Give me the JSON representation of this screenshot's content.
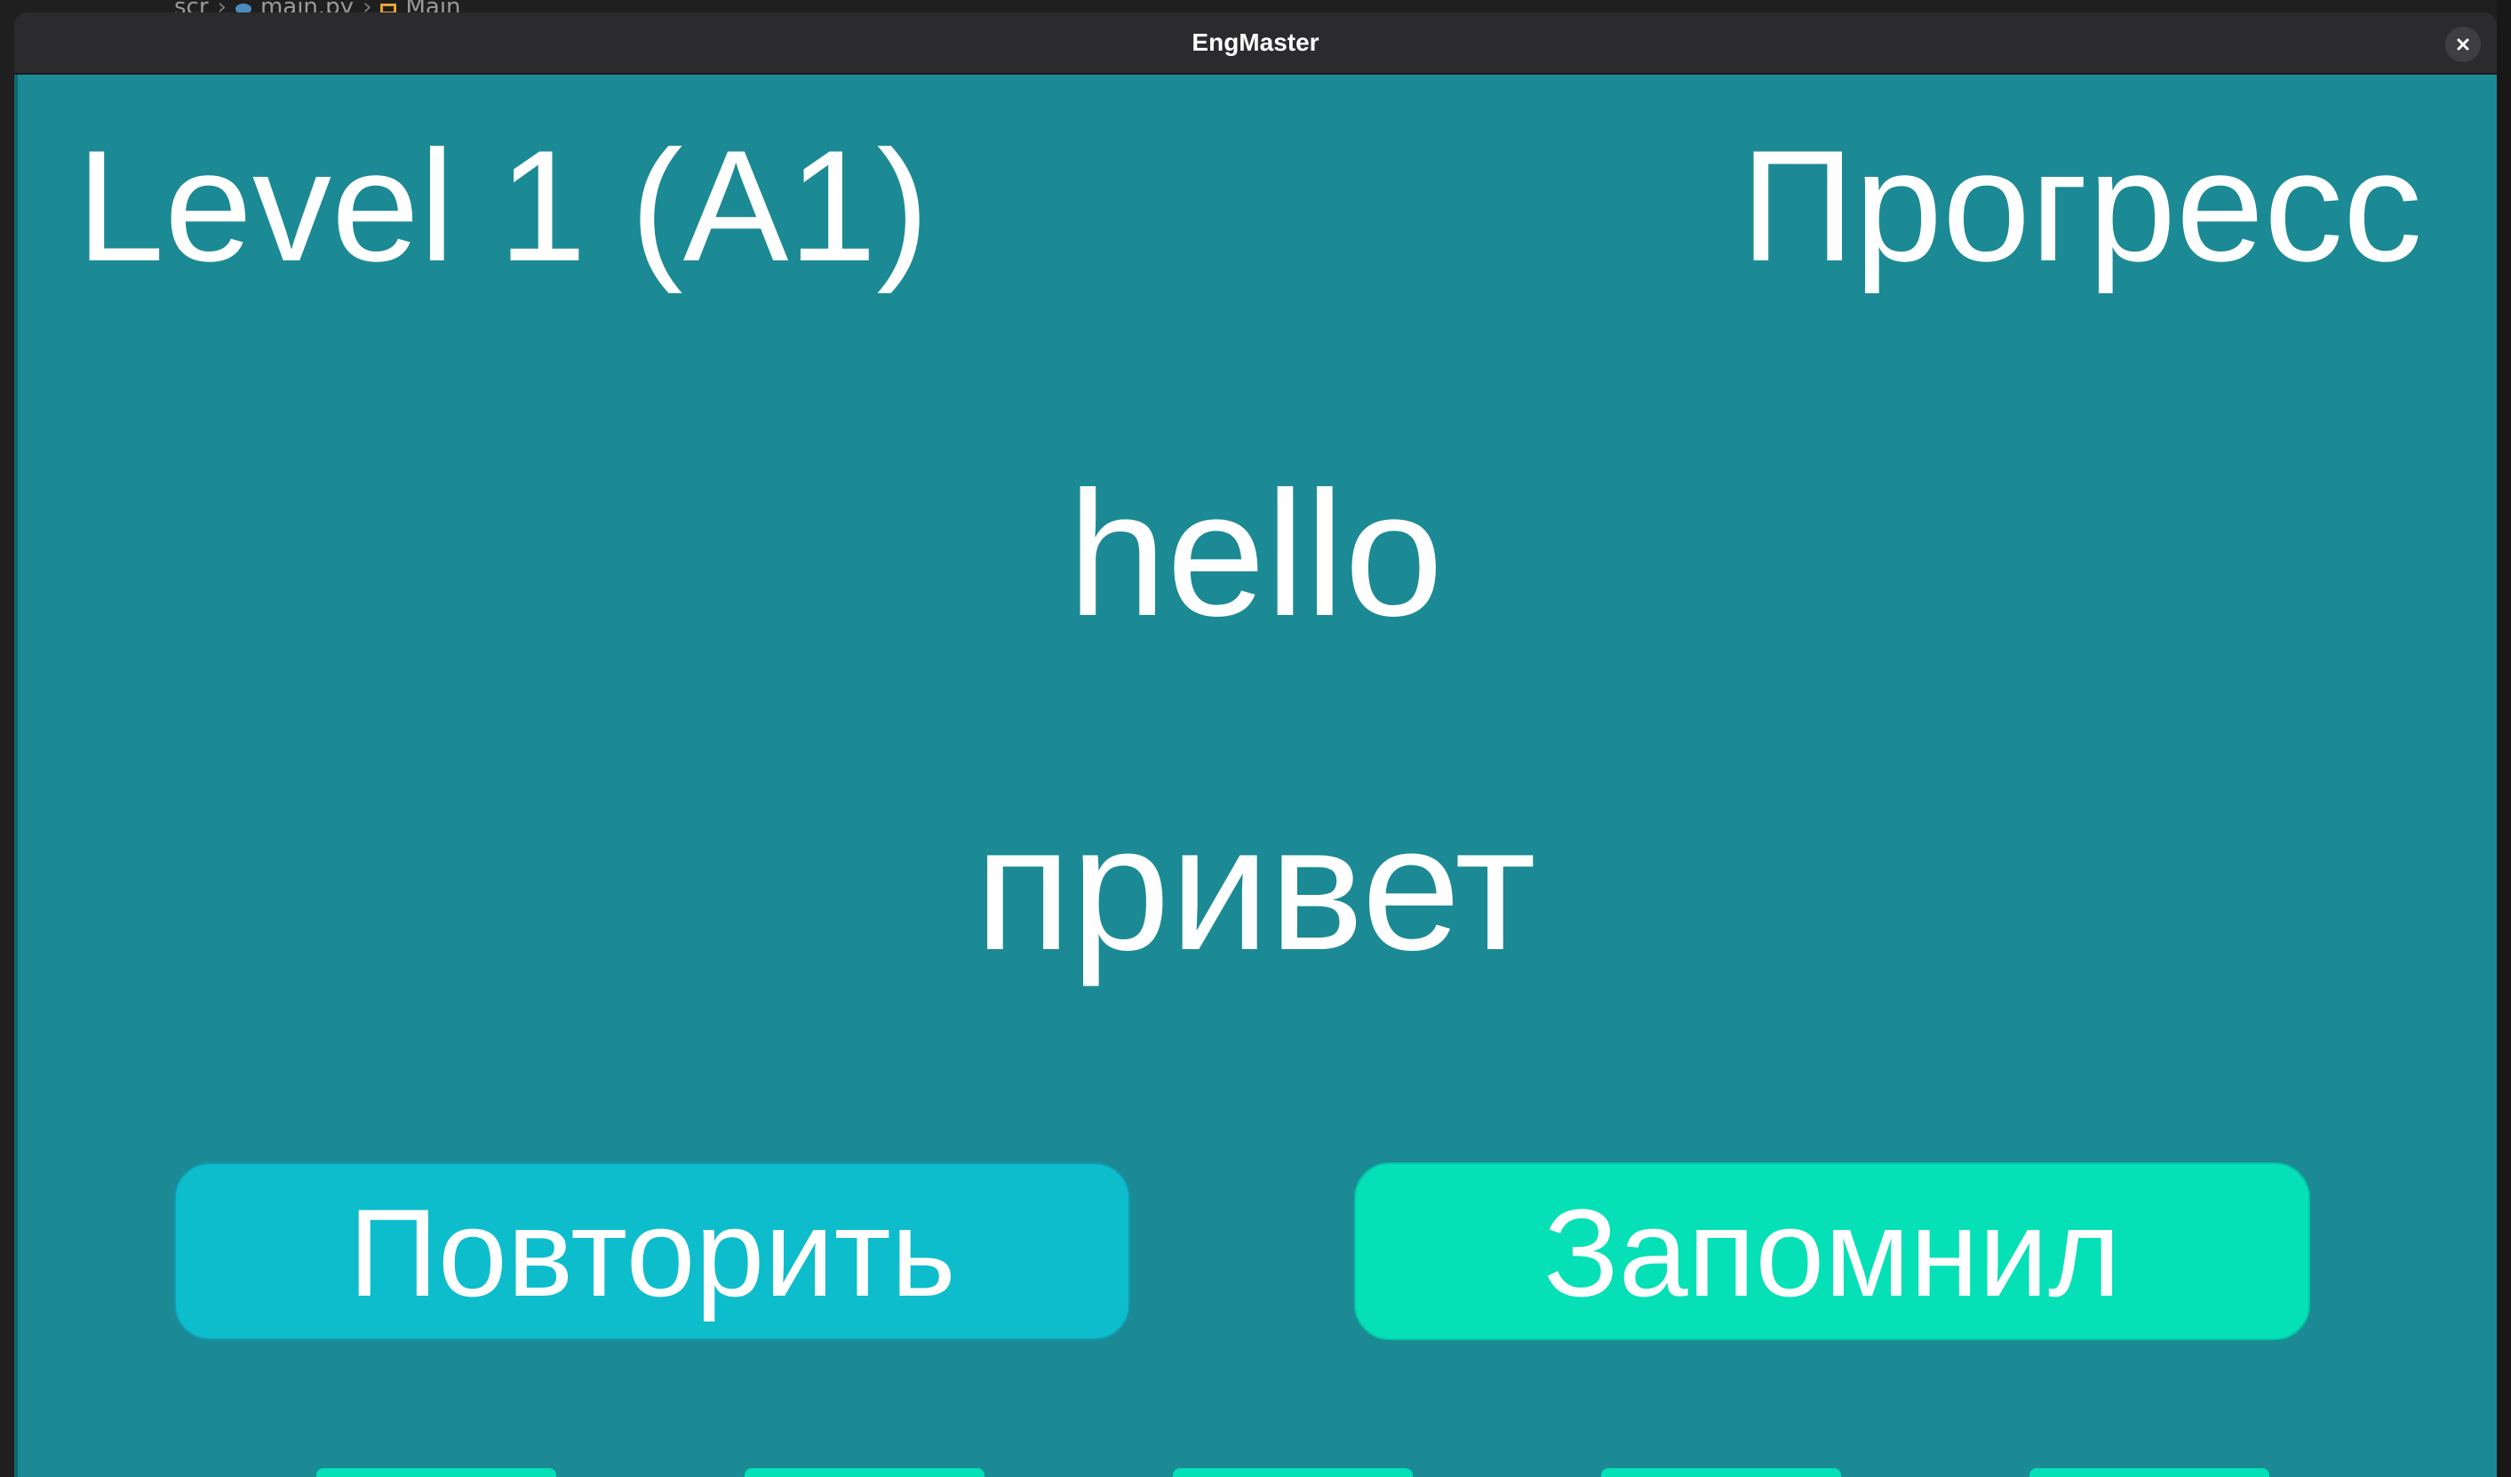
{
  "background_editor": {
    "breadcrumb": [
      "scr",
      "main.py",
      "Main"
    ]
  },
  "window": {
    "title": "EngMaster",
    "close_icon": "close-icon"
  },
  "header": {
    "level": "Level 1 (A1)",
    "progress": "Прогресс"
  },
  "card": {
    "word": "hello",
    "translation": "привет"
  },
  "actions": {
    "repeat_label": "Повторить",
    "remember_label": "Запомнил"
  },
  "colors": {
    "background": "#1b8a94",
    "repeat_button": "#0dbdcc",
    "remember_button": "#05e0b6",
    "titlebar": "#2b2b2d"
  }
}
